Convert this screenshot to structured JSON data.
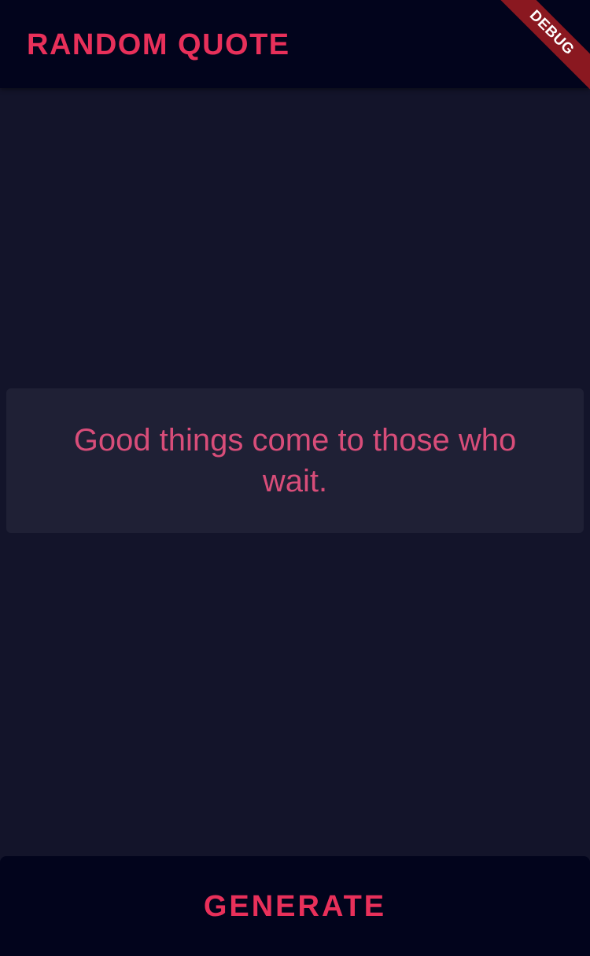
{
  "app_bar": {
    "title": "RANDOM QUOTE"
  },
  "debug_banner": {
    "label": "DEBUG"
  },
  "quote": {
    "text": "Good things come to those who wait."
  },
  "bottom_bar": {
    "generate_label": "GENERATE"
  },
  "colors": {
    "background": "#13142a",
    "app_bar": "#02041c",
    "accent": "#e8305a",
    "quote_text": "#d84d79",
    "card": "#1f2035",
    "debug_ribbon": "#8a1820"
  }
}
